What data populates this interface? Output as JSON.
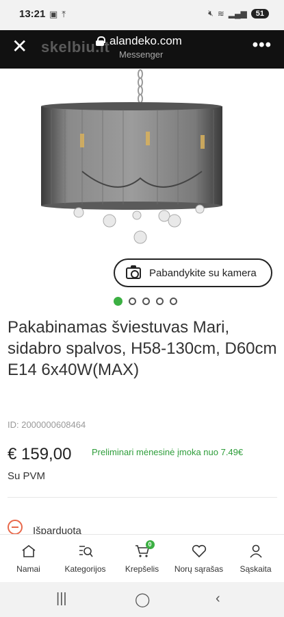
{
  "status_bar": {
    "time": "13:21",
    "battery": "51",
    "icons_left": [
      "screenshot-icon",
      "upload-icon"
    ],
    "icons_right": [
      "mute-icon",
      "wifi-icon",
      "signal-icon"
    ]
  },
  "browser": {
    "url": "alandeko.com",
    "subtitle": "Messenger",
    "watermark": "skelbiu.lt"
  },
  "product": {
    "camera_button": "Pabandykite su kamera",
    "carousel_count": 5,
    "carousel_active": 0,
    "title": "Pakabinamas šviestuvas Mari, sidabro spalvos, H58-130cm, D60cm E14 6x40W(MAX)",
    "id": "ID: 2000000608464",
    "price": "€ 159,00",
    "installment": "Preliminari mėnesinė įmoka nuo 7.49€",
    "vat": "Su PVM",
    "availability": "Išparduota"
  },
  "bottom_nav": {
    "items": [
      {
        "label": "Namai",
        "icon": "home-icon"
      },
      {
        "label": "Kategorijos",
        "icon": "category-search-icon"
      },
      {
        "label": "Krepšelis",
        "icon": "cart-icon",
        "badge": "0"
      },
      {
        "label": "Norų sąrašas",
        "icon": "heart-icon"
      },
      {
        "label": "Sąskaita",
        "icon": "user-icon"
      }
    ]
  },
  "colors": {
    "accent": "#3cb043",
    "sold": "#e8684a",
    "browser_bar": "#111111"
  }
}
